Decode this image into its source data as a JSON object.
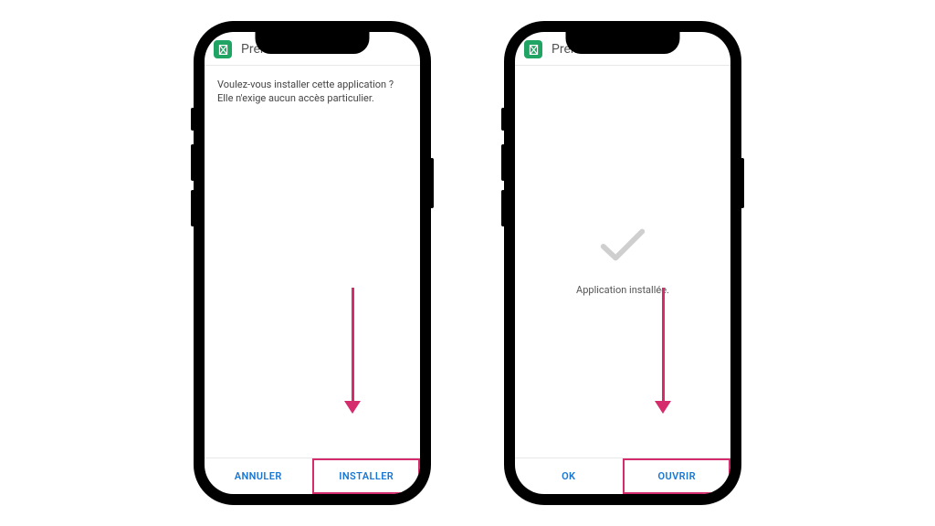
{
  "app": {
    "name": "PremierBet",
    "icon_name": "premierbet-logo-icon"
  },
  "screen1": {
    "prompt": "Voulez-vous installer cette application ? Elle n'exige aucun accès particulier.",
    "buttons": {
      "cancel": "ANNULER",
      "install": "INSTALLER"
    }
  },
  "screen2": {
    "status": "Application installée.",
    "buttons": {
      "ok": "OK",
      "open": "OUVRIR"
    }
  },
  "colors": {
    "accent": "#1976d2",
    "highlight": "#d42c6d",
    "app_icon_bg": "#1fa463"
  }
}
